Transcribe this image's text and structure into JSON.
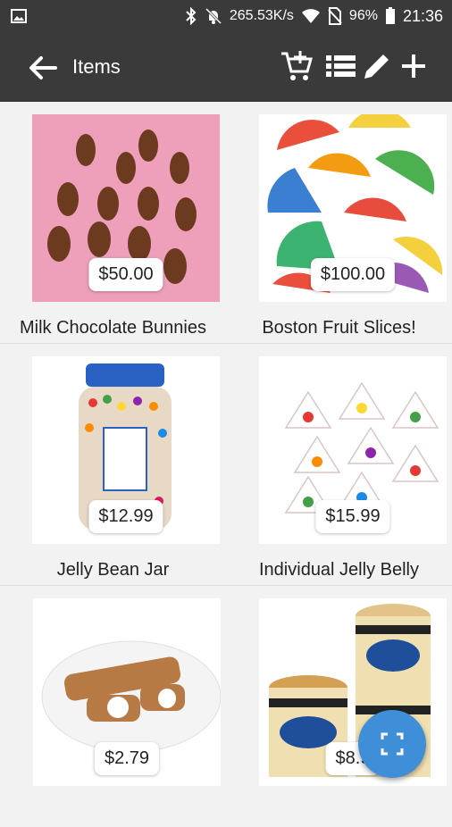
{
  "status_bar": {
    "network_speed": "265.53K/s",
    "battery": "96%",
    "time": "21:36"
  },
  "app_bar": {
    "title": "Items"
  },
  "items": [
    {
      "name": "Milk Chocolate Bunnies",
      "price": "$50.00"
    },
    {
      "name": "Boston Fruit Slices!",
      "price": "$100.00"
    },
    {
      "name": "Jelly Bean Jar",
      "price": "$12.99"
    },
    {
      "name": "Individual Jelly Belly",
      "price": "$15.99"
    },
    {
      "name": "",
      "price": "$2.79"
    },
    {
      "name": "",
      "price": "$8.9"
    }
  ],
  "colors": {
    "app_bar": "#3a3a3a",
    "fab": "#3f8ed8",
    "background": "#f2f2f2"
  }
}
